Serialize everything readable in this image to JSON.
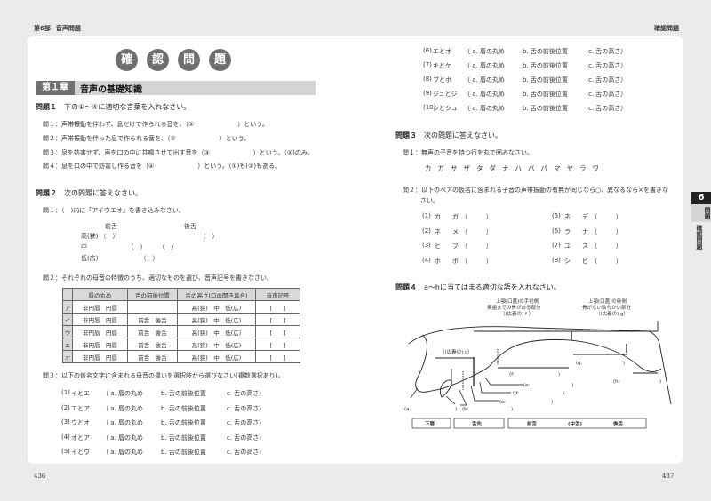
{
  "header": {
    "left_part": "第6部",
    "left_title": "音声問題",
    "right_title": "確認問題"
  },
  "title_chars": [
    "確",
    "認",
    "問",
    "題"
  ],
  "chapter": {
    "number": "第１章",
    "title": "音声の基礎知識"
  },
  "side_tab": {
    "number": "6",
    "section": "問題",
    "subsection": "確認問題"
  },
  "page_numbers": {
    "left": "436",
    "right": "437"
  },
  "q1": {
    "label": "問題１",
    "text": "下の①～④に適切な言葉を入れなさい。",
    "items": [
      {
        "label": "問１：",
        "text": "声帯振動を伴わず、息だけで作られる音を、（①　　　　　　　）という。"
      },
      {
        "label": "問２：",
        "text": "声帯振動を伴った息で作られる音を、（②　　　　　　　）という。"
      },
      {
        "label": "問３：",
        "text": "息を妨害せず、声を口の中に共鳴させて出す音を（③　　　　　　　）という。（②)のみ。"
      },
      {
        "label": "問４：",
        "text": "息を口の中で妨害し作る音を（④　　　　　　　）という。（①)も(②)もある。"
      }
    ]
  },
  "q2": {
    "label": "問題２",
    "text": "次の問題に答えなさい。",
    "sub1": {
      "label": "問１：",
      "text": "（　)内に「アイウエオ」を書き込みなさい。"
    },
    "vowel_chart": {
      "front": "前舌",
      "back": "後舌",
      "rows": [
        {
          "label": "高(狭)",
          "slots": "（　）　　　　　　　　　　　　　　（　）"
        },
        {
          "label": "中",
          "slots": "　　　　（　）　　　（　）"
        },
        {
          "label": "低(広)",
          "slots": "　　　　　　（　）"
        }
      ]
    },
    "sub2": {
      "label": "問２：",
      "text": "それぞれの母音の特徴のうち、適切なものを選び、音声記号を書きなさい。"
    },
    "table": {
      "headers": [
        "",
        "唇の丸め",
        "舌の前後位置",
        "舌の高さ(口の開き具合)",
        "音声記号"
      ],
      "rows": [
        {
          "kana": "ア",
          "lips": "非円唇　円唇",
          "position": "",
          "height": "高(狭)　中　低(広)",
          "symbol": "[　　]"
        },
        {
          "kana": "イ",
          "lips": "非円唇　円唇",
          "position": "前舌　後舌",
          "height": "高(狭)　中　低(広)",
          "symbol": "[　　]"
        },
        {
          "kana": "ウ",
          "lips": "非円唇　円唇",
          "position": "前舌　後舌",
          "height": "高(狭)　中　低(広)",
          "symbol": "[　　]"
        },
        {
          "kana": "エ",
          "lips": "非円唇　円唇",
          "position": "前舌　後舌",
          "height": "高(狭)　中　低(広)",
          "symbol": "[　　]"
        },
        {
          "kana": "オ",
          "lips": "非円唇　円唇",
          "position": "前舌　後舌",
          "height": "高(狭)　中　低(広)",
          "symbol": "[　　]"
        }
      ]
    },
    "sub3": {
      "label": "問３：",
      "text": "以下の仮名文字に含まれる母音の違いを選択肢から選びなさい(複数選択あり)。"
    },
    "pairs": [
      {
        "n": "(1)",
        "pair": "イとエ"
      },
      {
        "n": "(2)",
        "pair": "エとア"
      },
      {
        "n": "(3)",
        "pair": "ウとオ"
      },
      {
        "n": "(4)",
        "pair": "オとア"
      },
      {
        "n": "(5)",
        "pair": "イとウ"
      },
      {
        "n": "(6)",
        "pair": "エとオ"
      },
      {
        "n": "(7)",
        "pair": "キとケ"
      },
      {
        "n": "(8)",
        "pair": "ブとボ"
      },
      {
        "n": "(9)",
        "pair": "ジュとジ"
      },
      {
        "n": "(10)",
        "pair": "シとシュ"
      }
    ],
    "choices": {
      "a": "（ a. 唇の丸め",
      "b": "b. 舌の前後位置",
      "c": "c. 舌の高さ）"
    }
  },
  "q3": {
    "label": "問題３",
    "text": "次の問題に答えなさい。",
    "sub1": {
      "label": "問１：",
      "text": "無声の子音を持つ行を丸で囲みなさい。",
      "kana": "カガサザタダナハバパマヤラワ"
    },
    "sub2": {
      "label": "問２：",
      "text": "以下のペアの仮名に含まれる子音の声帯振動の有無が同じなら○、異なるなら×を書きな",
      "text2": "さい。"
    },
    "pairs": [
      {
        "n": "(1)",
        "pair": "カ　ガ"
      },
      {
        "n": "(2)",
        "pair": "ネ　メ"
      },
      {
        "n": "(3)",
        "pair": "ヒ　ブ"
      },
      {
        "n": "(4)",
        "pair": "ホ　ボ"
      },
      {
        "n": "(5)",
        "pair": "ネ　デ"
      },
      {
        "n": "(6)",
        "pair": "ラ　ナ"
      },
      {
        "n": "(7)",
        "pair": "ユ　ズ"
      },
      {
        "n": "(8)",
        "pair": "シ　ビ"
      }
    ],
    "blank": "（　　　）"
  },
  "q4": {
    "label": "問題４",
    "text": "a～hに当てはまる適切な語を入れなさい。",
    "diagram": {
      "top_label_f": [
        "上顎(口蓋)の手前側",
        "奥歯までの骨がある部分",
        "（(広義の) f ）"
      ],
      "top_label_g": [
        "上顎(口蓋)の奥側",
        "骨がない軟らかい部分",
        "（(広義の) g）"
      ],
      "label_c": "（(広義の) c）",
      "blanks": [
        "(a:",
        "(b:",
        "(c:",
        "(d:",
        "(e:",
        "(f:",
        "(g:",
        "(h:"
      ],
      "bottom_boxes": [
        "下唇",
        "舌先",
        "前舌",
        "(中舌)",
        "後舌"
      ]
    }
  }
}
